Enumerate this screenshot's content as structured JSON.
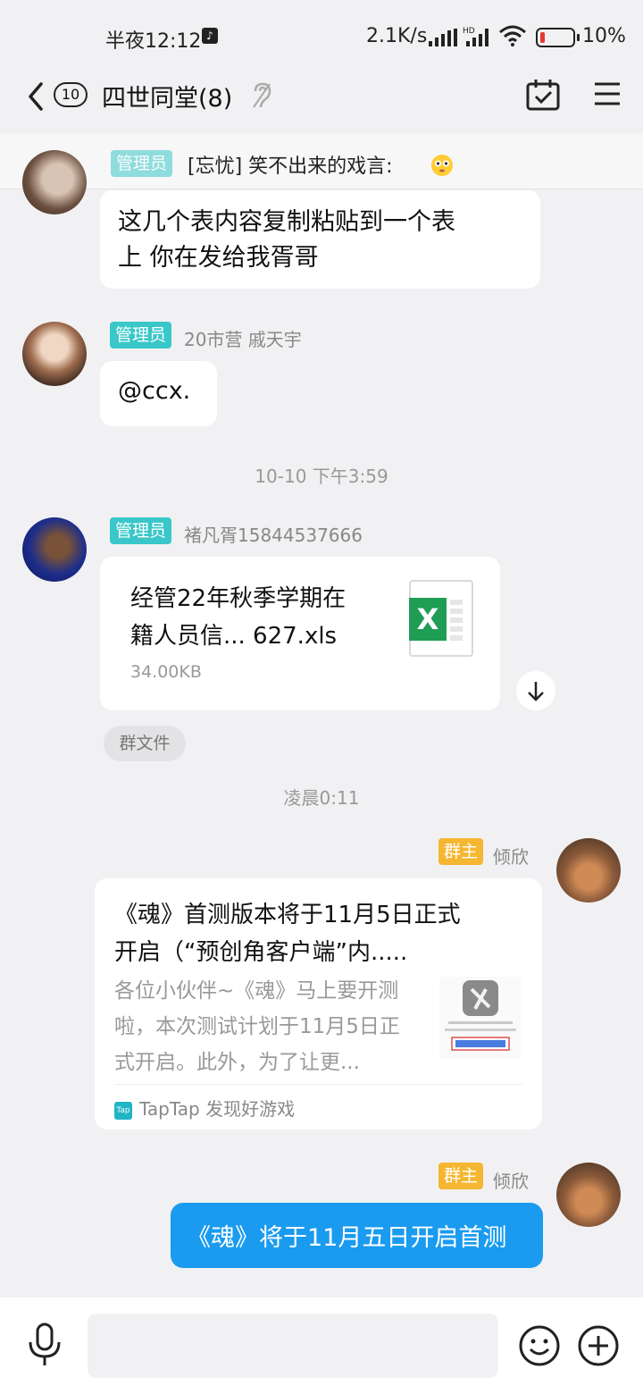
{
  "status_bar": {
    "time": "半夜12:12",
    "network_speed": "2.1K/s",
    "battery": "10%"
  },
  "header": {
    "unread_count": "10",
    "title": "四世同堂(8)"
  },
  "pinned": {
    "role": "管理员",
    "text": "[忘忧] 笑不出来的戏言:"
  },
  "messages": {
    "m1": {
      "text_line1": "这几个表内容复制粘贴到一个表",
      "text_line2": "上 你在发给我胥哥"
    },
    "m2": {
      "role": "管理员",
      "sender": "20市营 戚天宇",
      "text": "@ccx."
    },
    "ts1": "10-10 下午3:59",
    "m3": {
      "role": "管理员",
      "sender": "褚凡胥15844537666",
      "file_line1": "经管22年秋季学期在",
      "file_line2": "籍人员信... 627.xls",
      "file_size": "34.00KB",
      "tag": "群文件"
    },
    "ts2": "凌晨0:11",
    "m4": {
      "role": "群主",
      "sender": "倾欣",
      "title_line1": "《魂》首测版本将于11月5日正式",
      "title_line2": "开启（“预创角客户端”内.....",
      "desc_line1": "各位小伙伴~《魂》马上要开测",
      "desc_line2": "啦，本次测试计划于11月5日正",
      "desc_line3": "式开启。此外，为了让更...",
      "source": "TapTap 发现好游戏"
    },
    "m5": {
      "role": "群主",
      "sender": "倾欣",
      "text": "《魂》将于11月五日开启首测"
    }
  },
  "colors": {
    "admin_badge": "#39c7c9",
    "owner_badge": "#f5b731",
    "self_bubble": "#1a9bf0"
  }
}
